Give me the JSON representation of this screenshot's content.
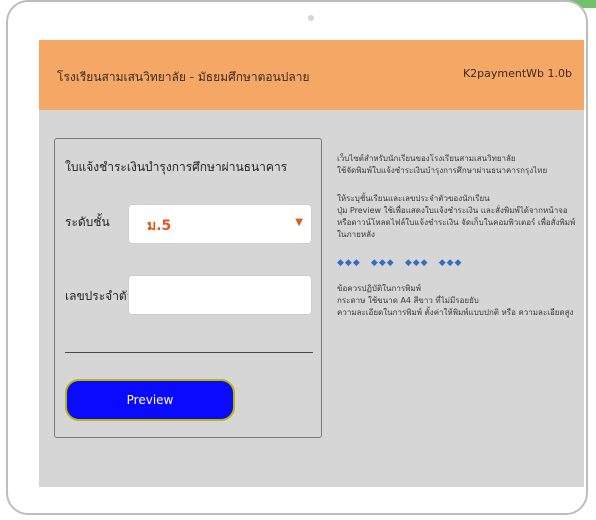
{
  "header": {
    "school_name": "โรงเรียนสามเสนวิทยาลัย - มัธยมศึกษาตอนปลาย",
    "app_version": "K2paymentWb 1.0b"
  },
  "form": {
    "heading": "ใบแจ้งชำระเงินบำรุงการศึกษาผ่านธนาคาร",
    "grade_label": "ระดับชั้น",
    "grade_value": "ม.5",
    "student_id_label": "เลขประจำตัว",
    "student_id_value": "",
    "preview_label": "Preview"
  },
  "info": {
    "para1_line1": "เว็บไซต์สำหรับนักเรียนของโรงเรียนสามเสนวิทยาลัย",
    "para1_line2": "ใช้จัดพิมพ์ใบแจ้งชำระเงินบำรุงการศึกษาผ่านธนาคารกรุงไทย",
    "para2_line1": "ให้ระบุชั้นเรียนและเลขประจำตัวของนักเรียน",
    "para2_line2": "ปุ่ม Preview ใช้เพื่อแสดงใบแจ้งชำระเงิน และสั่งพิมพ์ได้จากหน้าจอ",
    "para2_line3": "หรือดาวน์โหลดไฟล์ใบแจ้งชำระเงิน จัดเก็บในคอมพิวเตอร์ เพื่อสั่งพิมพ์ในภายหลัง",
    "links": [
      "◆◆◆",
      "◆◆◆",
      "◆◆◆",
      "◆◆◆"
    ],
    "para3_line1": "ข้อควรปฏิบัติในการพิมพ์",
    "para3_line2": "กระดาษ ใช้ขนาด A4 สีขาว ที่ไม่มีรอยยับ",
    "para3_line3": "ความละเอียดในการพิมพ์ ตั้งค่าให้พิมพ์แบบปกติ หรือ ความละเอียดสูง"
  }
}
